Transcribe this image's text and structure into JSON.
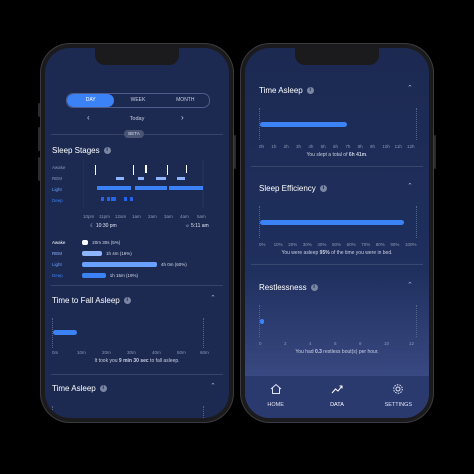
{
  "left": {
    "tabs": [
      "DAY",
      "WEEK",
      "MONTH"
    ],
    "date": "Today",
    "beta": "BETA",
    "sleep_stages": {
      "title": "Sleep Stages",
      "y_labels": [
        "Awake",
        "REM",
        "Light",
        "Deep"
      ],
      "x_ticks": [
        "10pm",
        "11pm",
        "12am",
        "1am",
        "2am",
        "3am",
        "4am",
        "5am"
      ],
      "start_time": "10:30 pm",
      "end_time": "5:11 am",
      "legend": [
        {
          "label": "Awake",
          "value": "20m 30s (5%)",
          "fraction": 0.05
        },
        {
          "label": "REM",
          "value": "1h 4m (16%)",
          "fraction": 0.16
        },
        {
          "label": "Light",
          "value": "4h 0m (60%)",
          "fraction": 0.6
        },
        {
          "label": "Deep",
          "value": "1h 15m (19%)",
          "fraction": 0.19
        }
      ]
    },
    "fall_asleep": {
      "title": "Time to Fall Asleep",
      "x_ticks": [
        "0m",
        "10m",
        "20m",
        "30m",
        "40m",
        "50m",
        "60m"
      ],
      "summary_pre": "It took you ",
      "summary_bold": "9 min 30 sec",
      "summary_post": " to fall asleep."
    },
    "time_asleep": {
      "title": "Time Asleep"
    }
  },
  "right": {
    "time_asleep": {
      "title": "Time Asleep",
      "x_ticks": [
        "0h",
        "1h",
        "2h",
        "3h",
        "4h",
        "5h",
        "6h",
        "7h",
        "8h",
        "9h",
        "10h",
        "11h",
        "12h"
      ],
      "value_hours": 6.68,
      "summary_pre": "You slept a total of ",
      "summary_bold": "6h 41m",
      "summary_post": "."
    },
    "efficiency": {
      "title": "Sleep Efficiency",
      "x_ticks": [
        "0%",
        "10%",
        "20%",
        "30%",
        "40%",
        "50%",
        "60%",
        "70%",
        "80%",
        "90%",
        "100%"
      ],
      "value_percent": 95,
      "summary_pre": "You were asleep ",
      "summary_bold": "95%",
      "summary_post": " of the time you were in bed."
    },
    "restlessness": {
      "title": "Restlessness",
      "x_ticks": [
        "0",
        "2",
        "4",
        "6",
        "8",
        "10",
        "12"
      ],
      "value": 0.3,
      "summary_pre": "You had ",
      "summary_bold": "0.3",
      "summary_post": " restless bout(s) per hour."
    },
    "nav": [
      {
        "label": "HOME",
        "icon": "home-icon"
      },
      {
        "label": "DATA",
        "icon": "chart-icon"
      },
      {
        "label": "SETTINGS",
        "icon": "gear-icon"
      }
    ]
  },
  "colors": {
    "accent": "#3b82f6",
    "screen": "#1c2a52",
    "nav": "#2b3a6e"
  }
}
